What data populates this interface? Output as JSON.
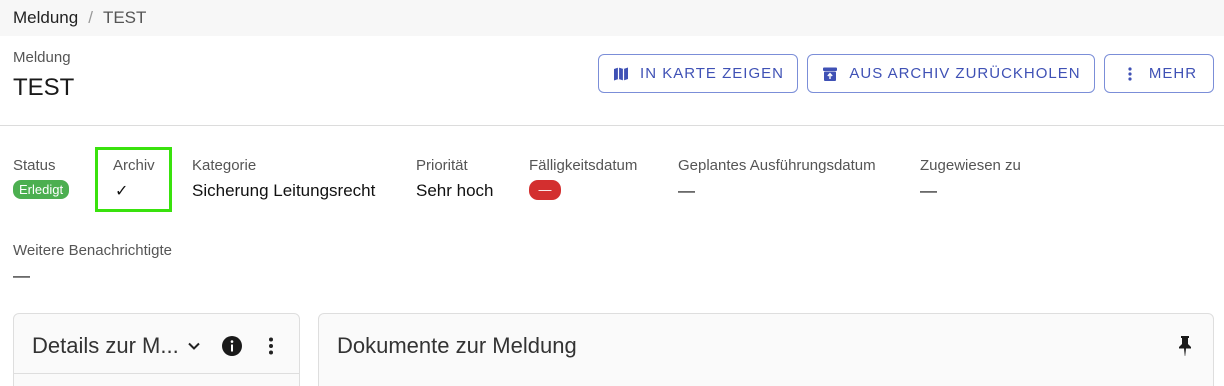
{
  "breadcrumb": {
    "parent": "Meldung",
    "separator": "/",
    "current": "TEST"
  },
  "header": {
    "subtitle": "Meldung",
    "title": "TEST"
  },
  "actions": {
    "show_on_map": {
      "label": "IN KARTE ZEIGEN",
      "icon": "map-icon"
    },
    "restore_from_archive": {
      "label": "AUS ARCHIV ZURÜCKHOLEN",
      "icon": "archive-restore-icon"
    },
    "more": {
      "label": "MEHR",
      "icon": "more-vertical-icon"
    }
  },
  "fields": {
    "status": {
      "label": "Status",
      "value": "Erledigt"
    },
    "archive": {
      "label": "Archiv",
      "value": "✓"
    },
    "category": {
      "label": "Kategorie",
      "value": "Sicherung Leitungsrecht"
    },
    "priority": {
      "label": "Priorität",
      "value": "Sehr hoch"
    },
    "due_date": {
      "label": "Fälligkeitsdatum",
      "value": "—"
    },
    "planned_date": {
      "label": "Geplantes Ausführungsdatum",
      "value": "—"
    },
    "assigned_to": {
      "label": "Zugewiesen zu",
      "value": "—"
    },
    "further_notified": {
      "label": "Weitere Benachrichtigte",
      "value": "—"
    }
  },
  "cards": {
    "details": {
      "title": "Details zur M..."
    },
    "documents": {
      "title": "Dokumente zur Meldung"
    }
  },
  "colors": {
    "accent": "#3f51b5",
    "status_done": "#4caf50",
    "due_badge": "#d32f2f",
    "highlight": "#39e20d"
  }
}
